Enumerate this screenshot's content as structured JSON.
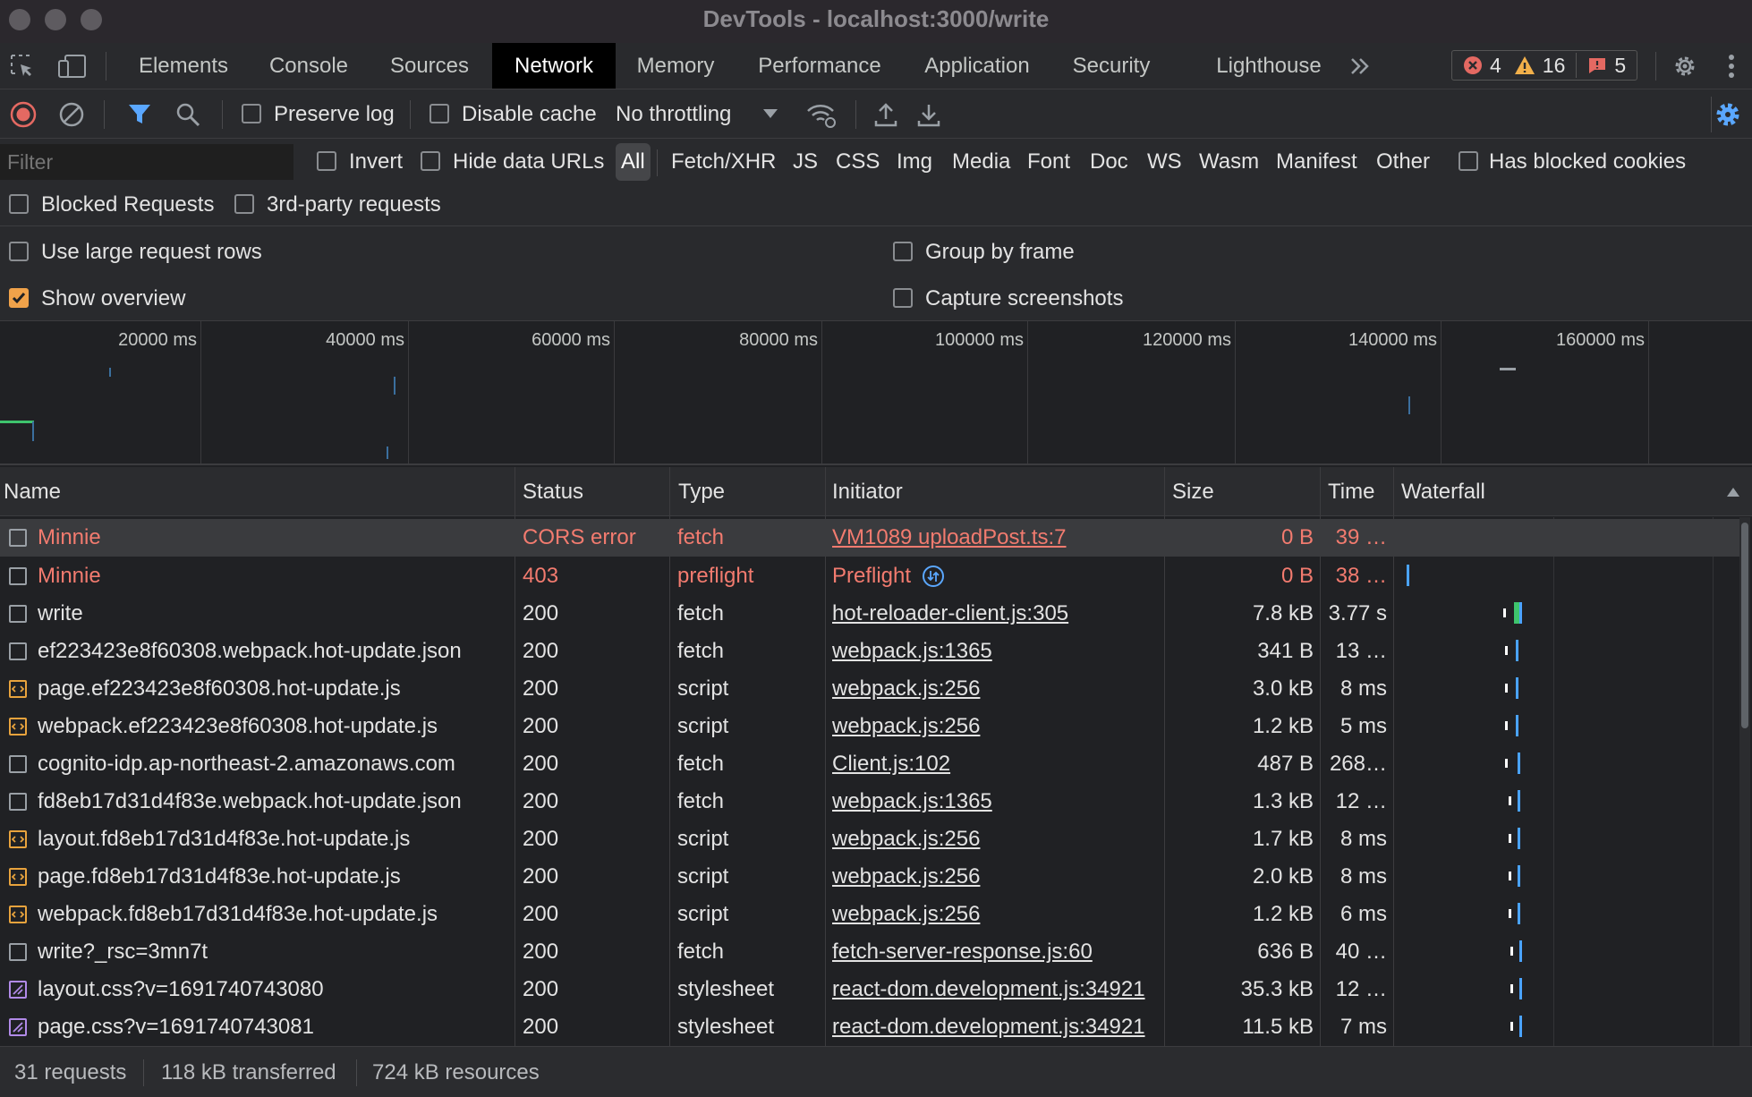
{
  "window": {
    "title": "DevTools - localhost:3000/write"
  },
  "tabs": [
    "Elements",
    "Console",
    "Sources",
    "Network",
    "Memory",
    "Performance",
    "Application",
    "Security",
    "Lighthouse"
  ],
  "selected_tab": "Network",
  "badges": {
    "errors": "4",
    "warnings": "16",
    "issues": "5"
  },
  "toolbar": {
    "preserve_log": "Preserve log",
    "disable_cache": "Disable cache",
    "throttling": "No throttling"
  },
  "filter": {
    "placeholder": "Filter",
    "invert": "Invert",
    "hide_data_urls": "Hide data URLs",
    "types": [
      "All",
      "Fetch/XHR",
      "JS",
      "CSS",
      "Img",
      "Media",
      "Font",
      "Doc",
      "WS",
      "Wasm",
      "Manifest",
      "Other"
    ],
    "selected_type": "All",
    "has_blocked_cookies": "Has blocked cookies",
    "blocked_requests": "Blocked Requests",
    "third_party": "3rd-party requests"
  },
  "settings": {
    "large_rows": "Use large request rows",
    "group_by_frame": "Group by frame",
    "show_overview": "Show overview",
    "show_overview_checked": true,
    "capture_screenshots": "Capture screenshots"
  },
  "overview": {
    "ticks": [
      "20000 ms",
      "40000 ms",
      "60000 ms",
      "80000 ms",
      "100000 ms",
      "120000 ms",
      "140000 ms",
      "160000 ms"
    ]
  },
  "columns": [
    "Name",
    "Status",
    "Type",
    "Initiator",
    "Size",
    "Time",
    "Waterfall"
  ],
  "requests": [
    {
      "name": "Minnie",
      "status": "CORS error",
      "type": "fetch",
      "initiator": "VM1089 uploadPost.ts:7",
      "size": "0 B",
      "time": "39 …",
      "error": true,
      "icon": "generic"
    },
    {
      "name": "Minnie",
      "status": "403",
      "type": "preflight",
      "initiator": "Preflight",
      "size": "0 B",
      "time": "38 …",
      "error": true,
      "icon": "generic"
    },
    {
      "name": "write",
      "status": "200",
      "type": "fetch",
      "initiator": "hot-reloader-client.js:305",
      "size": "7.8 kB",
      "time": "3.77 s",
      "icon": "generic"
    },
    {
      "name": "ef223423e8f60308.webpack.hot-update.json",
      "status": "200",
      "type": "fetch",
      "initiator": "webpack.js:1365",
      "size": "341 B",
      "time": "13 …",
      "icon": "generic"
    },
    {
      "name": "page.ef223423e8f60308.hot-update.js",
      "status": "200",
      "type": "script",
      "initiator": "webpack.js:256",
      "size": "3.0 kB",
      "time": "8 ms",
      "icon": "script"
    },
    {
      "name": "webpack.ef223423e8f60308.hot-update.js",
      "status": "200",
      "type": "script",
      "initiator": "webpack.js:256",
      "size": "1.2 kB",
      "time": "5 ms",
      "icon": "script"
    },
    {
      "name": "cognito-idp.ap-northeast-2.amazonaws.com",
      "status": "200",
      "type": "fetch",
      "initiator": "Client.js:102",
      "size": "487 B",
      "time": "268…",
      "icon": "generic"
    },
    {
      "name": "fd8eb17d31d4f83e.webpack.hot-update.json",
      "status": "200",
      "type": "fetch",
      "initiator": "webpack.js:1365",
      "size": "1.3 kB",
      "time": "12 …",
      "icon": "generic"
    },
    {
      "name": "layout.fd8eb17d31d4f83e.hot-update.js",
      "status": "200",
      "type": "script",
      "initiator": "webpack.js:256",
      "size": "1.7 kB",
      "time": "8 ms",
      "icon": "script"
    },
    {
      "name": "page.fd8eb17d31d4f83e.hot-update.js",
      "status": "200",
      "type": "script",
      "initiator": "webpack.js:256",
      "size": "2.0 kB",
      "time": "8 ms",
      "icon": "script"
    },
    {
      "name": "webpack.fd8eb17d31d4f83e.hot-update.js",
      "status": "200",
      "type": "script",
      "initiator": "webpack.js:256",
      "size": "1.2 kB",
      "time": "6 ms",
      "icon": "script"
    },
    {
      "name": "write?_rsc=3mn7t",
      "status": "200",
      "type": "fetch",
      "initiator": "fetch-server-response.js:60",
      "size": "636 B",
      "time": "40 …",
      "icon": "generic"
    },
    {
      "name": "layout.css?v=1691740743080",
      "status": "200",
      "type": "stylesheet",
      "initiator": "react-dom.development.js:34921",
      "size": "35.3 kB",
      "time": "12 …",
      "icon": "css"
    },
    {
      "name": "page.css?v=1691740743081",
      "status": "200",
      "type": "stylesheet",
      "initiator": "react-dom.development.js:34921",
      "size": "11.5 kB",
      "time": "7 ms",
      "icon": "css"
    }
  ],
  "status": {
    "requests": "31 requests",
    "transferred": "118 kB transferred",
    "resources": "724 kB resources"
  },
  "colors": {
    "accent": "#f0a24a",
    "error": "#f27b6f",
    "waterfall_blue": "#4aa3ff",
    "waterfall_green": "#3ec46d"
  }
}
